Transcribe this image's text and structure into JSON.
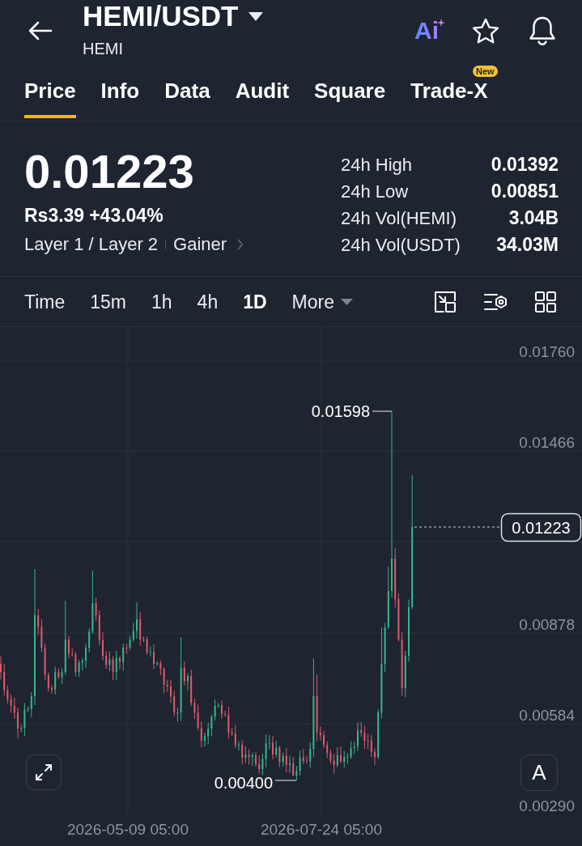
{
  "header": {
    "title": "HEMI/USDT",
    "subtitle": "HEMI",
    "ai_label": "Ai"
  },
  "tabs": [
    {
      "label": "Price",
      "selected": true
    },
    {
      "label": "Info",
      "selected": false
    },
    {
      "label": "Data",
      "selected": false
    },
    {
      "label": "Audit",
      "selected": false
    },
    {
      "label": "Square",
      "selected": false
    },
    {
      "label": "Trade-X",
      "selected": false,
      "badge": "New"
    }
  ],
  "ticker": {
    "last_price": "0.01223",
    "fiat_price": "Rs3.39",
    "change": "+43.04%",
    "tags": [
      "Layer 1 / Layer 2",
      "Gainer"
    ]
  },
  "stats": [
    {
      "label": "24h High",
      "value": "0.01392"
    },
    {
      "label": "24h Low",
      "value": "0.00851"
    },
    {
      "label": "24h Vol(HEMI)",
      "value": "3.04B"
    },
    {
      "label": "24h Vol(USDT)",
      "value": "34.03M"
    }
  ],
  "intervals": [
    {
      "label": "Time",
      "selected": false
    },
    {
      "label": "15m",
      "selected": false
    },
    {
      "label": "1h",
      "selected": false
    },
    {
      "label": "4h",
      "selected": false
    },
    {
      "label": "1D",
      "selected": true
    }
  ],
  "more_menu": {
    "label": "More"
  },
  "chart": {
    "price_axis": [
      "0.01760",
      "0.01466",
      "0.00878",
      "0.00584",
      "0.00290"
    ],
    "time_axis": [
      "2026-05-09 05:00",
      "2026-07-24 05:00"
    ],
    "high_label": "0.01598",
    "low_label": "0.00400",
    "current_price": "0.01223",
    "scale_button": "A"
  }
}
